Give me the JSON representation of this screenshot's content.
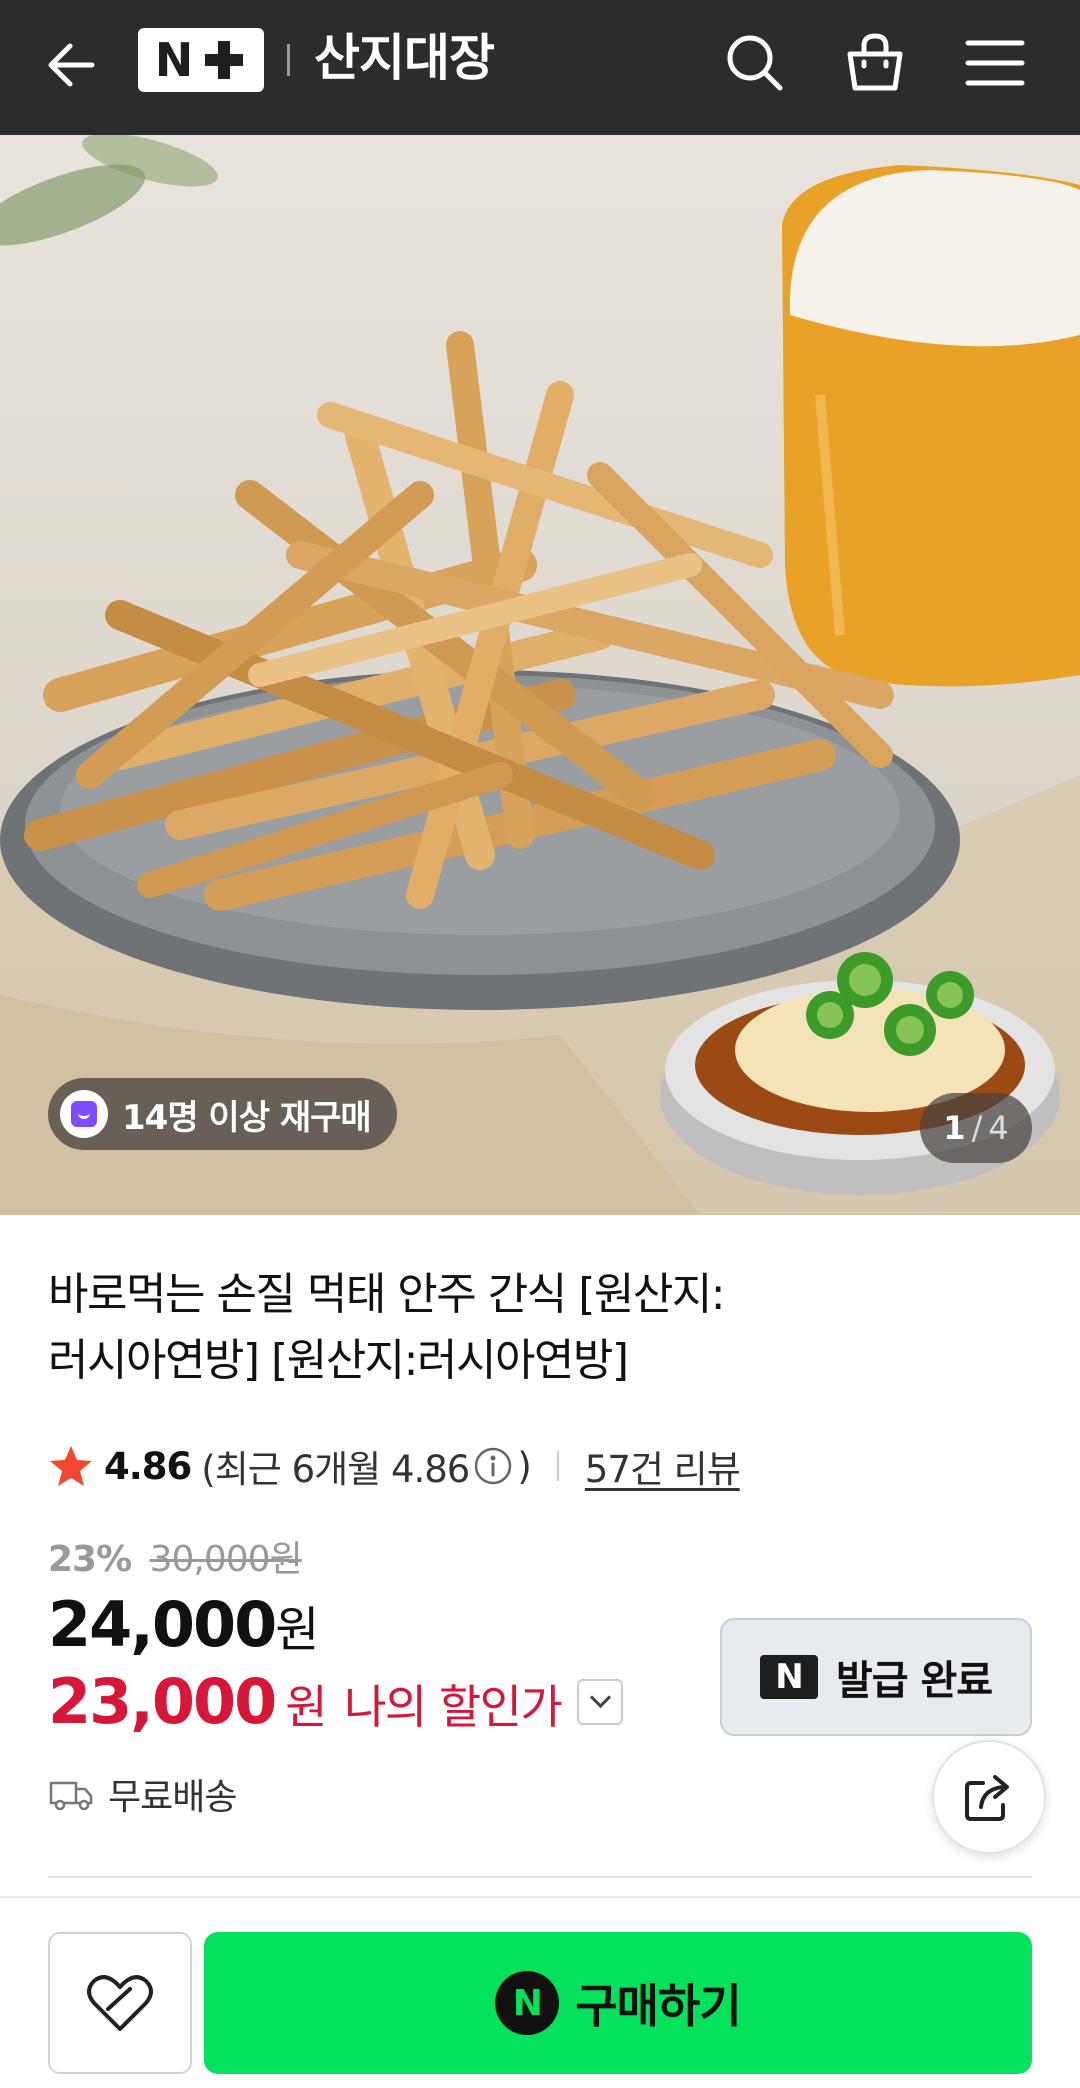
{
  "header": {
    "logo_n": "N",
    "store_name": "산지대장",
    "icons": [
      "back-arrow-icon",
      "search-icon",
      "shopping-bag-icon",
      "menu-icon"
    ],
    "bg_color": "#2a2c2e"
  },
  "hero": {
    "repurchase_badge": "14명 이상 재구매",
    "counter_current": "1",
    "counter_sep": "/",
    "counter_total": "4"
  },
  "product": {
    "title_line1": "바로먹는 손질 먹태 안주 간식 [원산지:",
    "title_line2": "러시아연방] [원산지:러시아연방]",
    "rating": "4.86",
    "recent_rating": "(최근 6개월 4.86",
    "recent_close": ")",
    "review_link": "57건 리뷰",
    "discount_pct": "23%",
    "original_price": "30,000원",
    "price_num": "24,000",
    "price_unit": "원",
    "my_price_num": "23,000",
    "my_price_unit": "원",
    "my_price_label": "나의 할인가",
    "shipping": "무료배송"
  },
  "coupon": {
    "n_mark": "N",
    "label": "발급 완료"
  },
  "bottom": {
    "buy_label": "구매하기",
    "buy_n": "N",
    "accent": "#03e25a"
  },
  "colors": {
    "sale_red": "#d6173a",
    "star_red": "#f5462f"
  }
}
